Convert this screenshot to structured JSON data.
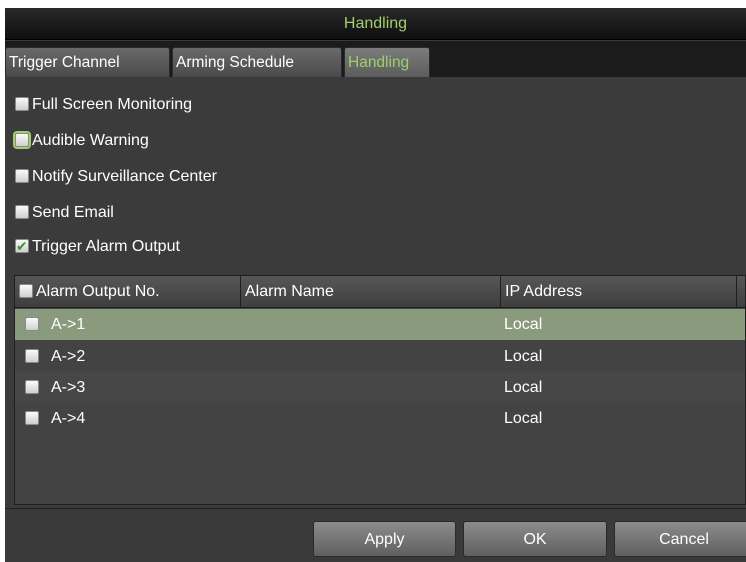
{
  "window": {
    "title": "Handling"
  },
  "tabs": [
    {
      "label": "Trigger Channel",
      "active": false
    },
    {
      "label": "Arming Schedule",
      "active": false
    },
    {
      "label": "Handling",
      "active": true
    }
  ],
  "options": [
    {
      "label": "Full Screen Monitoring",
      "checked": false
    },
    {
      "label": "Audible Warning",
      "checked": false,
      "focused": true
    },
    {
      "label": "Notify Surveillance Center",
      "checked": false
    },
    {
      "label": "Send Email",
      "checked": false
    },
    {
      "label": "Trigger Alarm Output",
      "checked": true
    }
  ],
  "table": {
    "headers": [
      "Alarm Output No.",
      "Alarm Name",
      "IP Address"
    ],
    "rows": [
      {
        "no": "A->1",
        "name": "",
        "ip": "Local",
        "selected": true
      },
      {
        "no": "A->2",
        "name": "",
        "ip": "Local"
      },
      {
        "no": "A->3",
        "name": "",
        "ip": "Local"
      },
      {
        "no": "A->4",
        "name": "",
        "ip": "Local"
      }
    ]
  },
  "buttons": {
    "apply": "Apply",
    "ok": "OK",
    "cancel": "Cancel"
  },
  "colors": {
    "accent": "#9fd06a",
    "selected_row": "#8a9a7c",
    "background": "#3b3b3b"
  }
}
